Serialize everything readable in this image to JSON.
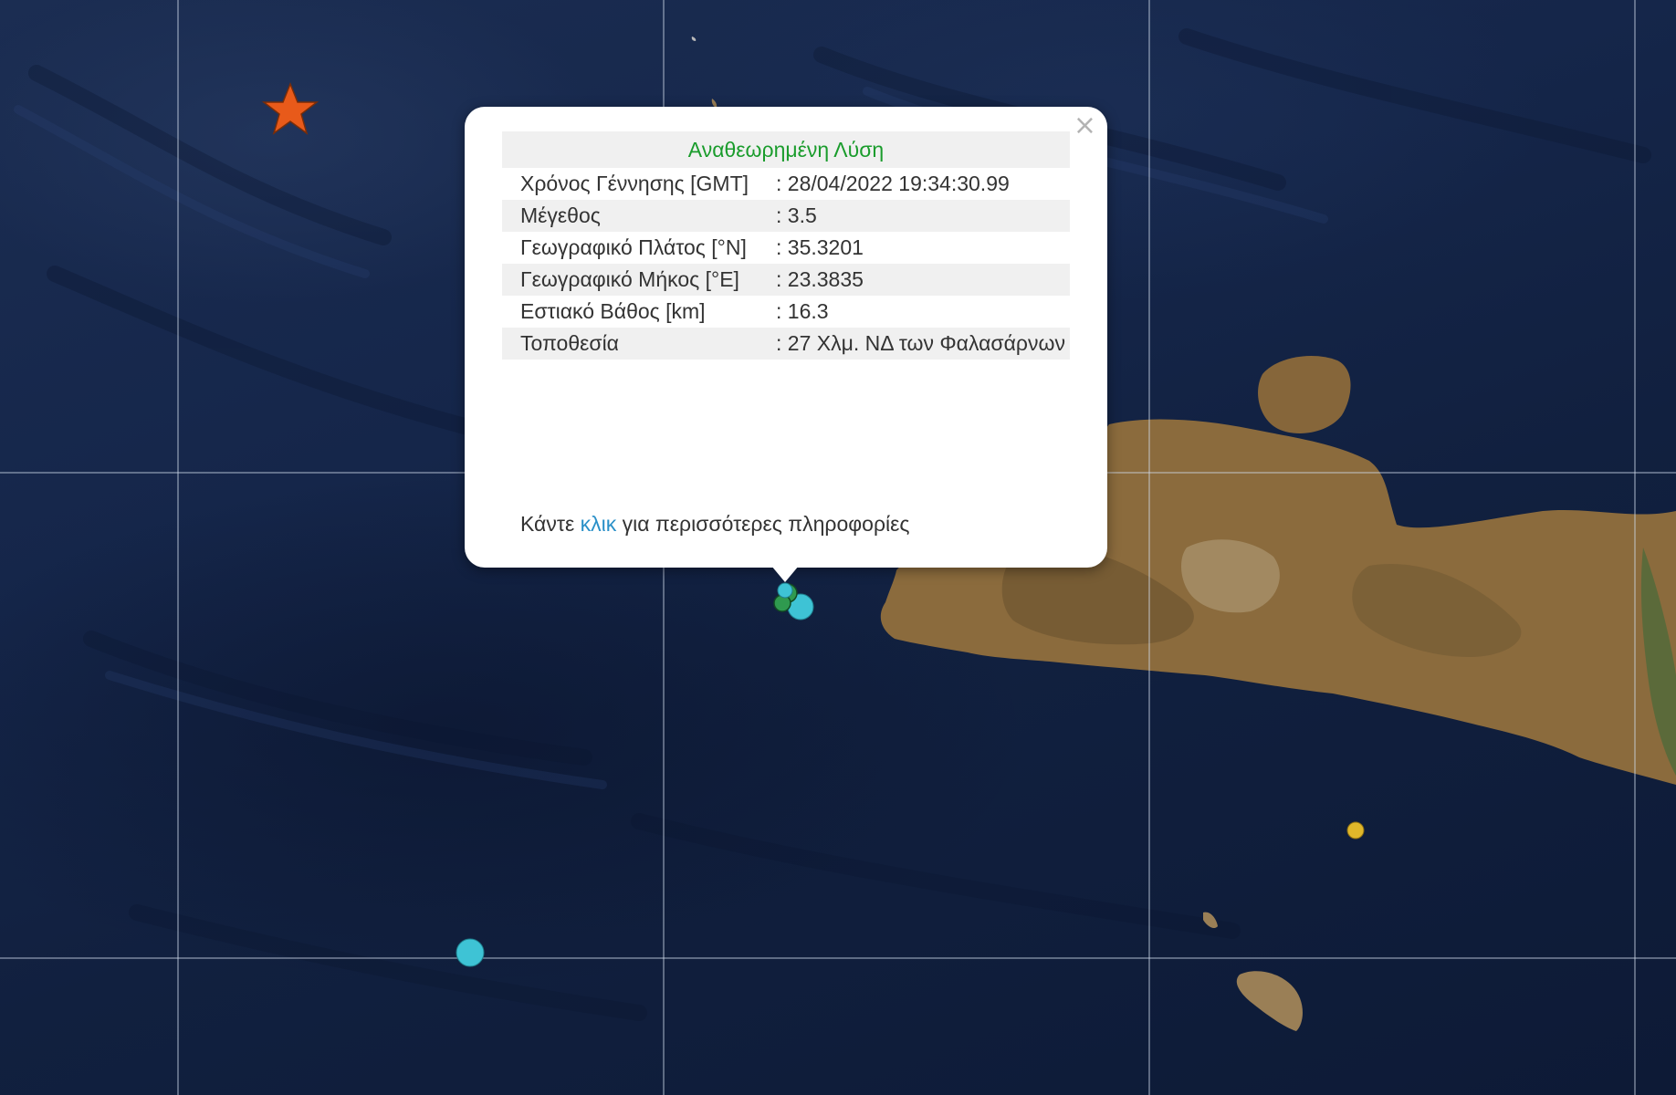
{
  "map": {
    "background_colors": {
      "sea": "#14264a",
      "land": "#8a6a3c",
      "grid": "#d2dceb"
    },
    "markers": [
      {
        "name": "star-marker",
        "color": "#e85a1a",
        "icon": "star-icon"
      },
      {
        "name": "event-cyan-1",
        "color": "#3ec3d5"
      },
      {
        "name": "event-cyan-2",
        "color": "#3ec3d5"
      },
      {
        "name": "event-green-1",
        "color": "#2f9a4f"
      },
      {
        "name": "event-green-2",
        "color": "#2f9a4f"
      },
      {
        "name": "event-yellow",
        "color": "#e0b72a"
      }
    ]
  },
  "popup": {
    "close_label": "×",
    "title": "Αναθεωρημένη Λύση",
    "rows": [
      {
        "label": "Χρόνος Γέννησης [GMT]",
        "value": ": 28/04/2022 19:34:30.99"
      },
      {
        "label": "Μέγεθος",
        "value": ": 3.5"
      },
      {
        "label": "Γεωγραφικό Πλάτος [°N]",
        "value": ": 35.3201"
      },
      {
        "label": "Γεωγραφικό Μήκος [°E]",
        "value": ": 23.3835"
      },
      {
        "label": "Εστιακό Βάθος [km]",
        "value": ": 16.3"
      },
      {
        "label": "Τοποθεσία",
        "value": ": 27 Χλμ. ΝΔ των Φαλασάρνων"
      }
    ],
    "footer": {
      "prefix": "Κάντε ",
      "link_text": "κλικ",
      "suffix": " για περισσότερες πληροφορίες"
    },
    "colors": {
      "title": "#1a9c2c",
      "link": "#2a90c8"
    }
  }
}
